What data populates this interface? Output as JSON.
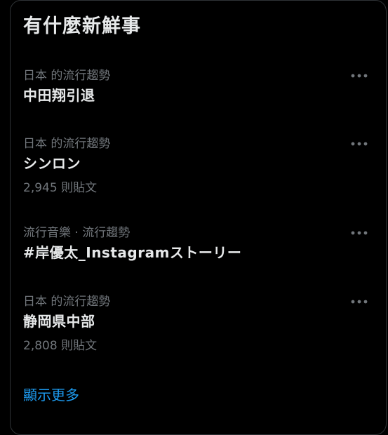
{
  "widget": {
    "title": "有什麼新鮮事",
    "show_more_label": "顯示更多"
  },
  "trends": [
    {
      "context": "日本 的流行趨勢",
      "name": "中田翔引退",
      "count": ""
    },
    {
      "context": "日本 的流行趨勢",
      "name": "シンロン",
      "count": "2,945 則貼文"
    },
    {
      "context": "流行音樂 · 流行趨勢",
      "name": "#岸優太_Instagramストーリー",
      "count": ""
    },
    {
      "context": "日本 的流行趨勢",
      "name": "静岡県中部",
      "count": "2,808 則貼文"
    }
  ],
  "icons": {
    "more": "more-horizontal-icon"
  },
  "colors": {
    "background": "#000000",
    "border": "#2f3336",
    "primary_text": "#e7e9ea",
    "secondary_text": "#71767b",
    "accent": "#1d9bf0"
  }
}
